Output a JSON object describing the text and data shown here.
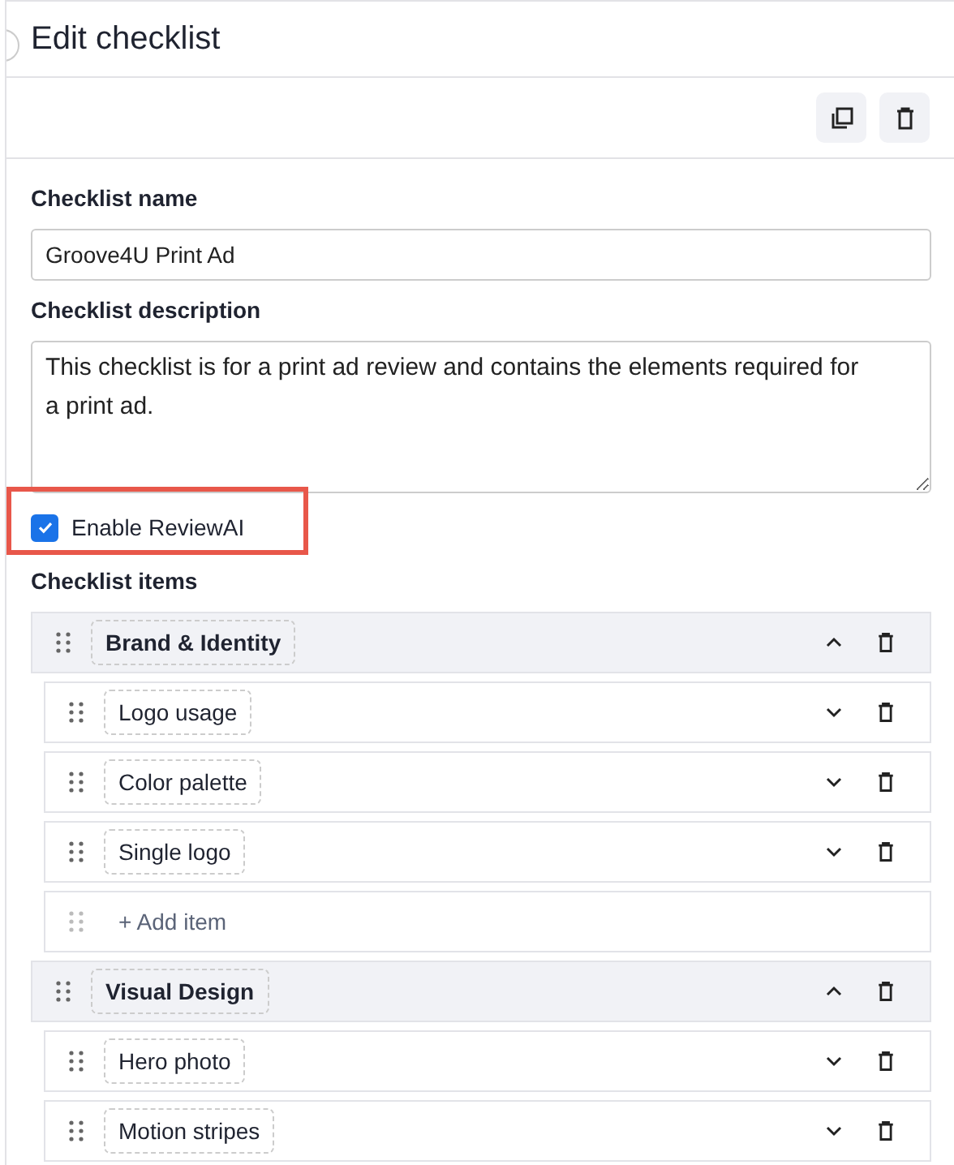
{
  "title": "Edit checklist",
  "name_field": {
    "label": "Checklist name",
    "value": "Groove4U Print Ad"
  },
  "description_field": {
    "label": "Checklist description",
    "value": "This checklist is for a print ad review and contains the elements required for a print ad."
  },
  "review_ai": {
    "label": "Enable ReviewAI",
    "checked": true,
    "highlighted": true
  },
  "items_label": "Checklist items",
  "groups": [
    {
      "title": "Brand & Identity",
      "expanded": true,
      "add_label": "+ Add item",
      "items": [
        {
          "title": "Logo usage",
          "expanded": false
        },
        {
          "title": "Color palette",
          "expanded": false
        },
        {
          "title": "Single logo",
          "expanded": false
        }
      ]
    },
    {
      "title": "Visual Design",
      "expanded": true,
      "items": [
        {
          "title": "Hero photo",
          "expanded": false
        },
        {
          "title": "Motion stripes",
          "expanded": false
        }
      ]
    }
  ]
}
